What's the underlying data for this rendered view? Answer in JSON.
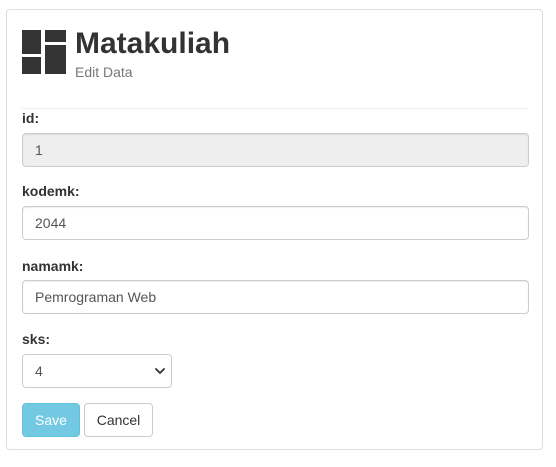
{
  "header": {
    "title": "Matakuliah",
    "subtitle": "Edit Data",
    "logo_icon": "dashboard-grid-icon"
  },
  "form": {
    "id": {
      "label": "id:",
      "value": "1",
      "readonly": true
    },
    "kodemk": {
      "label": "kodemk:",
      "value": "2044"
    },
    "namamk": {
      "label": "namamk:",
      "value": "Pemrograman Web"
    },
    "sks": {
      "label": "sks:",
      "selected": "4"
    }
  },
  "buttons": {
    "save_label": "Save",
    "cancel_label": "Cancel"
  },
  "colors": {
    "save_bg": "#5bc0de",
    "readonly_bg": "#eeeeee",
    "text": "#333333",
    "muted": "#777777"
  }
}
